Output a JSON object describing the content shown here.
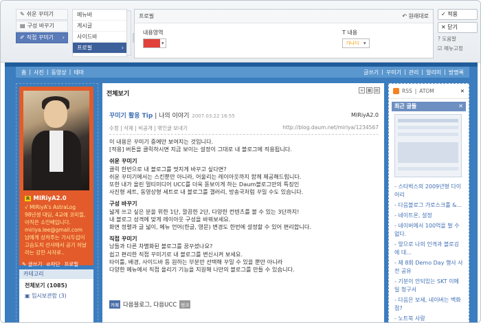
{
  "left_tabs": [
    {
      "label": "쉬운 꾸미기",
      "icon": "edit-icon"
    },
    {
      "label": "구성 바꾸기",
      "icon": "layout-icon"
    },
    {
      "label": "직접 꾸미기",
      "icon": "brush-icon",
      "active": true
    }
  ],
  "menu_list": [
    "메뉴바",
    "게시글",
    "사이드바",
    "프로필"
  ],
  "properties": {
    "title": "프로필",
    "reset_label": "원래대로",
    "content_area_label": "내용영역",
    "content_area_color": "#e0413a",
    "text_label": "T 내용",
    "text_color_sample": "가나다"
  },
  "right_buttons": {
    "apply": "적용",
    "close": "닫기",
    "help": "도움말",
    "fix_menu": "메뉴고정"
  },
  "blog": {
    "nav_left": [
      "홈",
      "사진",
      "동영상",
      "테마"
    ],
    "nav_right": [
      "글쓰기",
      "꾸미기",
      "관리",
      "알리미",
      "방명록"
    ],
    "profile": {
      "name": "MIRiyA2.0",
      "lines": [
        "√ MIRiyA's AstraLog",
        "98년생 대딩, 4교에 코미필,",
        "아직은 소인배입니다.",
        "miriya.lee@gmail.com",
        "남에게 상처주는 가시두섭이",
        "고슴도치 선샤에서 공기 하날",
        "라는 강한 사자로.."
      ],
      "write_label": "글쓰기",
      "block_label": "차단",
      "profile_label": "프로필"
    },
    "category": {
      "title": "카테고리",
      "items": [
        "전체보기 (1085)",
        "임시보관함 (3)"
      ]
    },
    "center_title": "전체보기",
    "post": {
      "title_highlight": "꾸미기 활용 Tip",
      "title_rest": " | 나의 이야기",
      "date": "2007.03.22 16:55",
      "author": "MIRiyA2.0",
      "meta_left": "수정 | 삭제 | 비공개 | 엮인글 보내기",
      "meta_right": "http://blog.daum.net/miriya/1234567",
      "body": [
        "이 내용은 꾸미기 중에만 보여지는 것입니다.",
        "[적용] 버튼을 클릭하시면 지금 보이는 설정이 그대로 내 블로그에 적용됩니다.",
        "",
        "#쉬운 꾸미기",
        "클릭 한번으로 내 블로그를 멋지게 바꾸고 싶다면?",
        "쉬운 꾸미기에서는 스킨뿐만 아니라, 어울리는 레이아웃까지 함께 제공해드립니다.",
        "또한 내가 올린 멀티미디어 UCC를 더욱 돋보이게 하는 Daum블로그만의 특징인",
        "사진형 세트, 동영상형 세트로 내 블로그를 갤러리, 방송국처럼 꾸밀 수도 있습니다.",
        "",
        "#구성 바꾸기",
        "넓게 쓰고 싶은 분을 위한 1단, 깔끔한 2단, 다양한 컨텐츠를 볼 수 있는 3단까지!",
        "내 블로그 성격에 맞게 레이아웃 구성을 바꿔보세요.",
        "화면 정렬과 글 넓이, 메뉴 언어(한글, 영문) 변경도 한번에 설정할 수 있어 편리합니다.",
        "",
        "#직접 꾸미기",
        "남들과 다른 차별화된 블로그를 꿈꾸셨나요?",
        "쉽고 편리한 직접 꾸미기로 내 블로그를 변신시켜 보세요.",
        "타이틀, 배경, 사이드바 등 원하는 부분만 선택해 꾸밀 수 있을 뿐만 아니라",
        "다양한 메뉴에서 직접 올리기 기능을 지원해 나만의 블로그를 만들 수 있습니다."
      ],
      "footer_badge": "카페",
      "footer_text": "다음블로그, 다음UCC",
      "footer_more": "링크"
    },
    "rss": {
      "rss": "RSS",
      "atom": "ATOM"
    },
    "recent": {
      "title": "최근 글들",
      "items": [
        "스타벅스의 2009년형 다이어리",
        "다음블로그 가로스크롤 &...",
        "네이트온, 설정",
        "네이버에서 100억을 벌 수 없다.",
        "앞으로 나의 인격과 블로깅에 대...",
        "제 8회 Demo Day 행사 사전 공유",
        "기분이 안되있는 SKT 이메일 청구서",
        "다음은 보세, 네이버는 백화점?",
        "노트북 사랑"
      ]
    }
  }
}
